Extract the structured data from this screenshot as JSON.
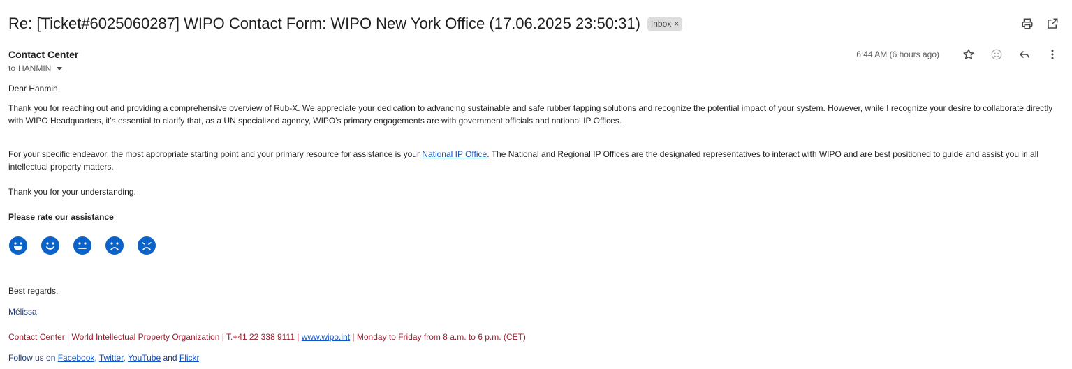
{
  "email": {
    "subject": "Re: [Ticket#6025060287] WIPO Contact Form: WIPO New York Office (17.06.2025 23:50:31)",
    "label_chip": "Inbox",
    "label_chip_remove": "×",
    "sender_name": "Contact Center",
    "recipient_prefix": "to",
    "recipient": "HANMIN",
    "timestamp": "6:44 AM (6 hours ago)"
  },
  "icons": {
    "print": "print-icon",
    "open_new_window": "open-in-new-window-icon",
    "star": "star-icon",
    "emoji": "add-reaction-icon",
    "reply": "reply-icon",
    "more": "more-vert-icon"
  },
  "body": {
    "greeting": "Dear Hanmin,",
    "para1": "Thank you for reaching out and providing a comprehensive overview of Rub-X. We appreciate your dedication to advancing sustainable and safe rubber tapping solutions and recognize the potential impact of your system. However, while I recognize your desire to collaborate directly with WIPO Headquarters, it's essential to clarify that, as a UN specialized agency, WIPO's primary engagements are with government officials and national IP Offices.",
    "para2_before": "For your specific endeavor, the most appropriate starting point and your primary resource for assistance is your ",
    "para2_link": "National IP Office",
    "para2_after": ". The National and Regional IP Offices are the designated representatives to interact with WIPO and are best positioned to guide and assist you in all intellectual property matters.",
    "thanks": "Thank you for your understanding.",
    "rate_title": "Please rate our assistance",
    "rating_faces": [
      "very-happy",
      "happy",
      "neutral",
      "sad",
      "very-sad"
    ],
    "closing": "Best regards,",
    "signature": "Mélissa",
    "footer_part1": "Contact Center | World Intellectual Property Organization | T.+41 22 338 9111 | ",
    "footer_link": "www.wipo.int",
    "footer_part2": " | Monday to Friday from 8 a.m. to 6 p.m. (CET)",
    "follow_prefix": "Follow us on ",
    "follow_links": [
      "Facebook",
      "Twitter",
      "YouTube",
      "Flickr"
    ],
    "follow_sep1": ", ",
    "follow_sep2": ", ",
    "follow_sep3": " and ",
    "follow_end": "."
  },
  "colors": {
    "smiley_blue": "#0b63c9",
    "footer_red": "#a01c2c",
    "link_blue": "#1155cc"
  }
}
